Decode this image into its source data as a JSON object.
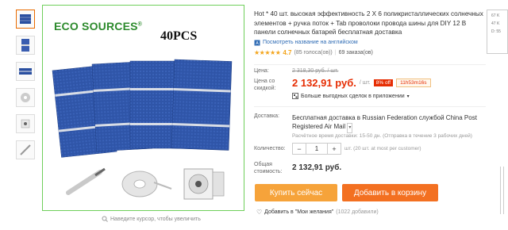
{
  "gallery": {
    "logo": "ECO SOURCES",
    "logo_mark": "®",
    "pcs_label": "40PCS",
    "zoom_hint": "Наведите курсор, чтобы увеличить"
  },
  "product": {
    "title": "Hot * 40 шт. высокая эффективность 2 X 6 поликристаллических солнечных элементов + ручка поток + Tab проволоки провода шины для DIY 12 В панели солнечных батарей бесплатная доставка",
    "translate_link": "Посмотреть название на английском",
    "rating": "4.7",
    "votes": "(85 голоса(ов))",
    "orders": "69 заказа(ов)"
  },
  "pricing": {
    "price_label": "Цена:",
    "old_price": "2 318,30 руб. / шт.",
    "discount_label_line1": "Цена со",
    "discount_label_line2": "скидкой:",
    "new_price": "2 132,91 руб.",
    "per_unit": "/ шт.",
    "discount_badge": "8% off",
    "timer": "11h53m16s",
    "deals": "Больше выгодных сделок в приложении"
  },
  "shipping": {
    "label": "Доставка:",
    "text": "Бесплатная доставка в Russian Federation службой China Post Registered Air Mail",
    "eta": "Расчётное время доставки: 15-50 дн. (Отправка в течение 3 рабочих дней)"
  },
  "quantity": {
    "label": "Количество:",
    "value": "1",
    "minus": "−",
    "plus": "+",
    "note": "шт. (20 шт. at most per customer)"
  },
  "total": {
    "label_line1": "Общая",
    "label_line2": "стоимость:",
    "value": "2 132,91 руб."
  },
  "actions": {
    "buy_now": "Купить сейчас",
    "add_to_cart": "Добавить в корзину",
    "wishlist": "Добавить в \"Мои желания\"",
    "wishlist_count": "(1022 добавили)"
  },
  "side_widget": {
    "values": [
      "67 K",
      "47 K",
      "D: 55"
    ]
  },
  "colors": {
    "price_red": "#e62e04",
    "buy_orange": "#f6a33a",
    "cart_orange": "#f37021",
    "star": "#f3a41b",
    "link_blue": "#2e6bb4"
  }
}
